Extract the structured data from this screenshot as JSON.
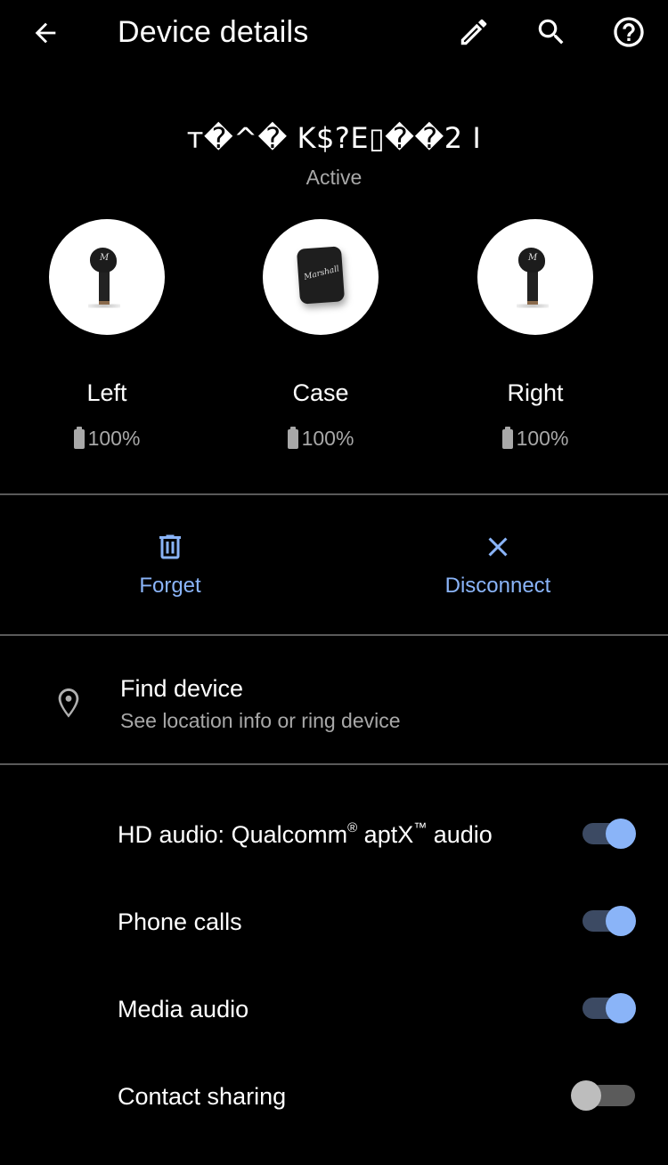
{
  "appbar": {
    "title": "Device details",
    "icons": [
      "back-arrow-icon",
      "edit-pencil-icon",
      "search-icon",
      "help-circle-icon"
    ]
  },
  "device": {
    "name": "ᴛ�^� K$?E▯��2 I",
    "status": "Active"
  },
  "parts": [
    {
      "label": "Left",
      "battery": "100%",
      "battery_level": 1.0,
      "image": "left-earbud"
    },
    {
      "label": "Case",
      "battery": "100%",
      "battery_level": 1.0,
      "image": "charging-case"
    },
    {
      "label": "Right",
      "battery": "100%",
      "battery_level": 1.0,
      "image": "right-earbud"
    }
  ],
  "actions": {
    "forget": {
      "label": "Forget",
      "icon": "trash-icon"
    },
    "disconnect": {
      "label": "Disconnect",
      "icon": "close-x-icon"
    }
  },
  "find_device": {
    "title": "Find device",
    "subtitle": "See location info or ring device",
    "icon": "location-pin-icon"
  },
  "toggles": [
    {
      "label_main": "HD audio: Qualcomm",
      "label_reg": "®",
      "label_mid": " aptX",
      "label_tm": "™",
      "label_end": " audio",
      "enabled": true
    },
    {
      "label": "Phone calls",
      "enabled": true
    },
    {
      "label": "Media audio",
      "enabled": true
    },
    {
      "label": "Contact sharing",
      "enabled": false
    }
  ],
  "colors": {
    "accent": "#8ab4f8",
    "background": "#000000",
    "secondary_text": "#a8a8a8",
    "divider": "#5a5a5a",
    "switch_on_track": "#3c4a63",
    "switch_off_thumb": "#bdbdbd"
  }
}
